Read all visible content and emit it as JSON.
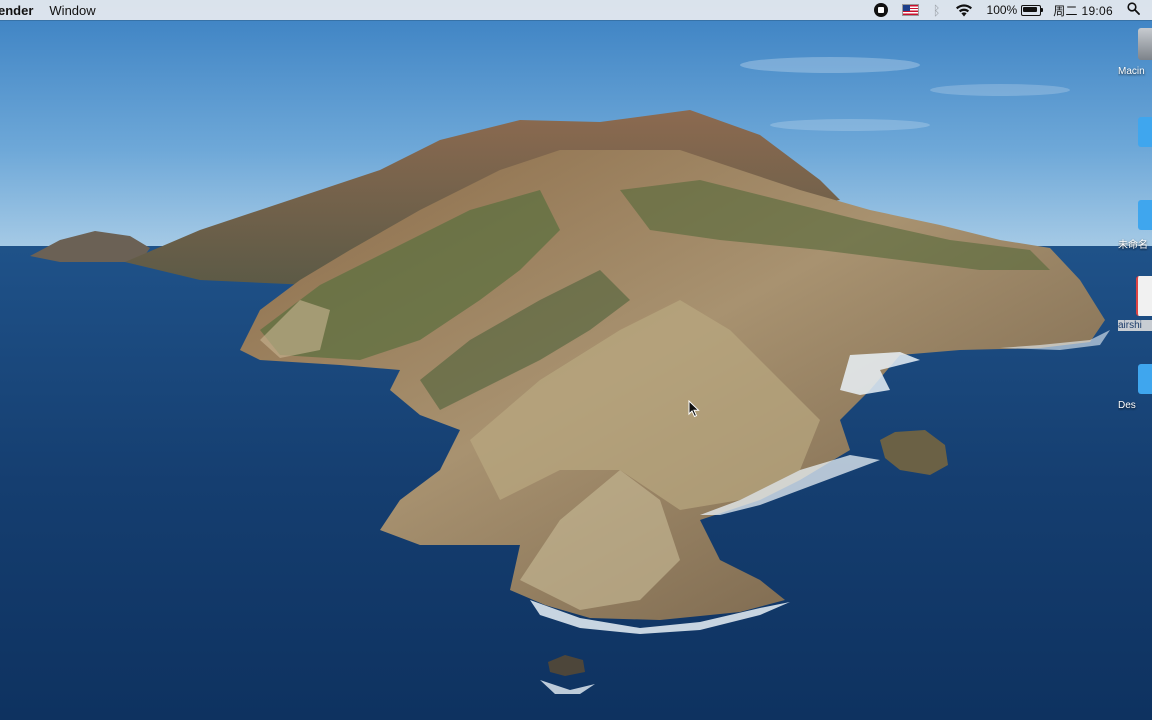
{
  "menubar": {
    "app_name": "ender",
    "menus": [
      "Window"
    ],
    "battery": "100%",
    "clock": "周二 19:06"
  },
  "desktop_icons": [
    {
      "label": "Macin",
      "icon": "hard-drive-icon",
      "color": "#9aa0a6"
    },
    {
      "label": "",
      "icon": "folder-icon",
      "color": "#3fa6ee"
    },
    {
      "label": "未命名",
      "icon": "folder-icon",
      "color": "#3fa6ee"
    },
    {
      "label": "airshi",
      "icon": "document-icon",
      "color": "#eeeeee"
    },
    {
      "label": "Des",
      "icon": "folder-icon",
      "color": "#3fa6ee"
    }
  ],
  "wallpaper": {
    "name": "catalina-island-icon"
  }
}
